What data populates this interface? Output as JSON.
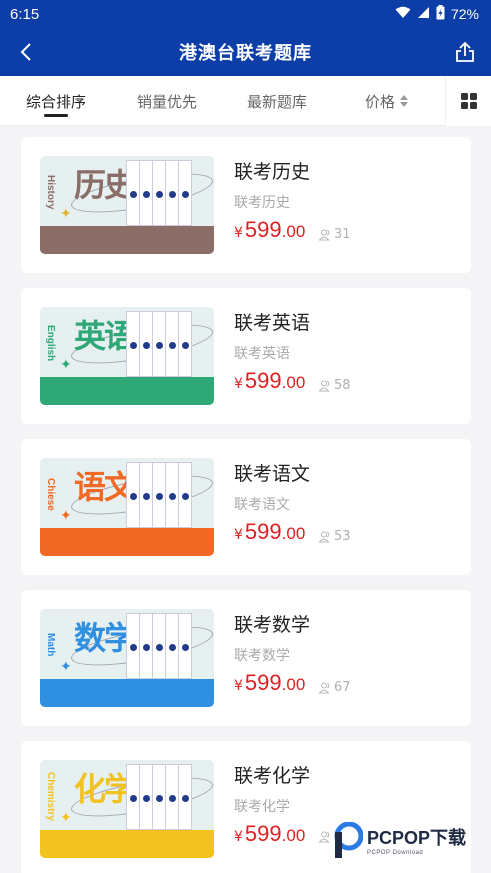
{
  "status_bar": {
    "time": "6:15",
    "battery": "72%"
  },
  "header": {
    "title": "港澳台联考题库"
  },
  "sort": {
    "tabs": [
      {
        "label": "综合排序"
      },
      {
        "label": "销量优先"
      },
      {
        "label": "最新题库"
      },
      {
        "label": "价格"
      }
    ]
  },
  "products": [
    {
      "title": "联考历史",
      "subtitle": "联考历史",
      "currency": "¥",
      "price_int": "599",
      "price_dec": ".00",
      "count": "31",
      "cover_big": "历史",
      "cover_en": "History",
      "accent": "#8a6d66",
      "glyph": "史",
      "star_color": "#e0b43a"
    },
    {
      "title": "联考英语",
      "subtitle": "联考英语",
      "currency": "¥",
      "price_int": "599",
      "price_dec": ".00",
      "count": "58",
      "cover_big": "英语",
      "cover_en": "English",
      "accent": "#2fa877",
      "glyph": "语",
      "star_color": "#2fa877"
    },
    {
      "title": "联考语文",
      "subtitle": "联考语文",
      "currency": "¥",
      "price_int": "599",
      "price_dec": ".00",
      "count": "53",
      "cover_big": "语文",
      "cover_en": "Chiese",
      "accent": "#f06a26",
      "glyph": "文",
      "star_color": "#f06a26"
    },
    {
      "title": "联考数学",
      "subtitle": "联考数学",
      "currency": "¥",
      "price_int": "599",
      "price_dec": ".00",
      "count": "67",
      "cover_big": "数学",
      "cover_en": "Math",
      "accent": "#2f8fe0",
      "glyph": "学",
      "star_color": "#2f8fe0"
    },
    {
      "title": "联考化学",
      "subtitle": "联考化学",
      "currency": "¥",
      "price_int": "599",
      "price_dec": ".00",
      "count": "",
      "cover_big": "化学",
      "cover_en": "Chemistry",
      "accent": "#f2c21f",
      "glyph": "学",
      "star_color": "#f2c21f"
    }
  ],
  "watermark": {
    "name": "PCPOP下载",
    "tagline": "PCPOP Download"
  }
}
